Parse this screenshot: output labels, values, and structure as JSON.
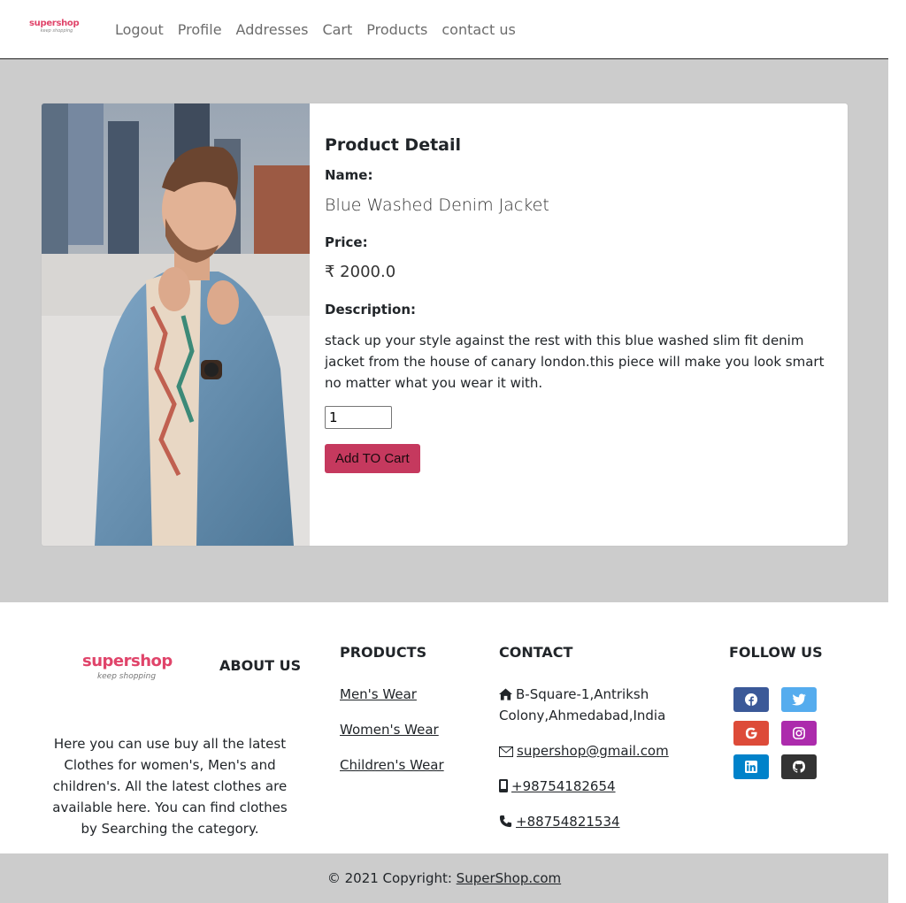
{
  "brand": {
    "name": "supershop",
    "tagline": "keep shopping",
    "color": "#e0446a"
  },
  "nav": {
    "items": [
      "Logout",
      "Profile",
      "Addresses",
      "Cart",
      "Products",
      "contact us"
    ]
  },
  "product": {
    "heading": "Product Detail",
    "name_label": "Name:",
    "name": "Blue Washed Denim Jacket",
    "price_label": "Price:",
    "price": "₹ 2000.0",
    "description_label": "Description:",
    "description": "stack up your style against the rest with this blue washed slim fit denim jacket from the house of canary london.this piece will make you look smart no matter what you wear it with.",
    "quantity": "1",
    "add_button": "Add TO Cart",
    "button_color": "#c5395e"
  },
  "footer": {
    "about_heading": "ABOUT US",
    "about_text": "Here you can use buy all the latest Clothes for women's, Men's and children's. All the latest clothes are available here. You can find clothes by Searching the category.",
    "products_heading": "PRODUCTS",
    "product_links": [
      "Men's Wear",
      "Women's Wear",
      "Children's Wear"
    ],
    "contact_heading": "CONTACT",
    "address": "B-Square-1,Antriksh Colony,Ahmedabad,India",
    "email": "supershop@gmail.com",
    "mobile": "+98754182654",
    "phone": "+88754821534",
    "follow_heading": "FOLLOW US",
    "social": [
      {
        "name": "facebook-icon",
        "color": "#3b5998"
      },
      {
        "name": "twitter-icon",
        "color": "#55acee"
      },
      {
        "name": "google-icon",
        "color": "#dd4b39"
      },
      {
        "name": "instagram-icon",
        "color": "#ac2bac"
      },
      {
        "name": "linkedin-icon",
        "color": "#0082ca"
      },
      {
        "name": "github-icon",
        "color": "#333333"
      }
    ],
    "copyright_prefix": "© 2021 Copyright: ",
    "copyright_link": "SuperShop.com"
  }
}
